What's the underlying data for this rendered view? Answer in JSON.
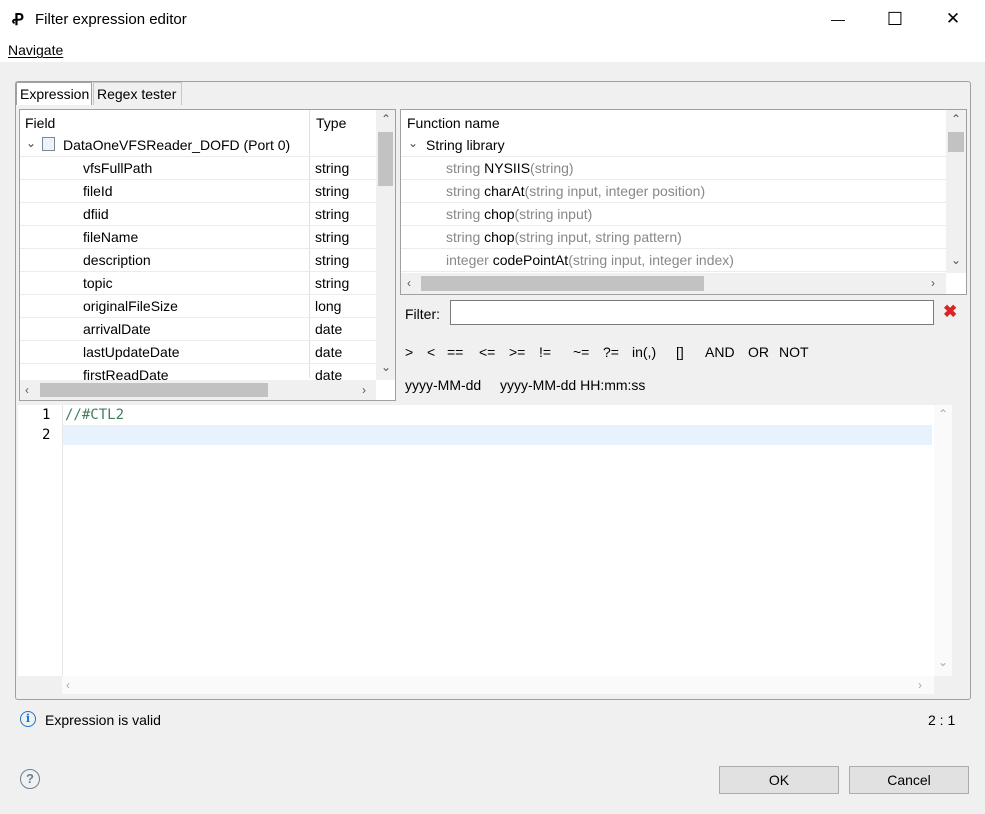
{
  "window": {
    "title": "Filter expression editor",
    "menu_navigate": "Navigate",
    "minimize": "—",
    "maximize": "☐",
    "close": "✕"
  },
  "tabs": [
    {
      "label": "Expression"
    },
    {
      "label": "Regex tester"
    }
  ],
  "fields": {
    "header_field": "Field",
    "header_type": "Type",
    "group": "DataOneVFSReader_DOFD (Port 0)",
    "rows": [
      {
        "name": "vfsFullPath",
        "type": "string"
      },
      {
        "name": "fileId",
        "type": "string"
      },
      {
        "name": "dfiid",
        "type": "string"
      },
      {
        "name": "fileName",
        "type": "string"
      },
      {
        "name": "description",
        "type": "string"
      },
      {
        "name": "topic",
        "type": "string"
      },
      {
        "name": "originalFileSize",
        "type": "long"
      },
      {
        "name": "arrivalDate",
        "type": "date"
      },
      {
        "name": "lastUpdateDate",
        "type": "date"
      },
      {
        "name": "firstReadDate",
        "type": "date"
      }
    ]
  },
  "functions": {
    "header": "Function name",
    "group": "String library",
    "rows": [
      {
        "ret": "string",
        "fn": "NYSIIS",
        "args": "(string)"
      },
      {
        "ret": "string",
        "fn": "charAt",
        "args": "(string input, integer position)"
      },
      {
        "ret": "string",
        "fn": "chop",
        "args": "(string input)"
      },
      {
        "ret": "string",
        "fn": "chop",
        "args": "(string input, string pattern)"
      },
      {
        "ret": "integer",
        "fn": "codePointAt",
        "args": "(string input, integer index)"
      }
    ]
  },
  "filter": {
    "label": "Filter:",
    "value": ""
  },
  "operators": [
    ">",
    "<",
    "==",
    "<=",
    ">=",
    "!=",
    "~=",
    "?=",
    "in(,)",
    "[]",
    "AND",
    "OR",
    "NOT"
  ],
  "date_formats": [
    "yyyy-MM-dd",
    "yyyy-MM-dd HH:mm:ss"
  ],
  "editor": {
    "lines": [
      {
        "num": "1",
        "text": "//#CTL2"
      },
      {
        "num": "2",
        "text": ""
      }
    ]
  },
  "status": {
    "message": "Expression is valid",
    "cursor": "2 : 1",
    "info_icon": "i",
    "help_icon": "?"
  },
  "buttons": {
    "ok": "OK",
    "cancel": "Cancel"
  }
}
